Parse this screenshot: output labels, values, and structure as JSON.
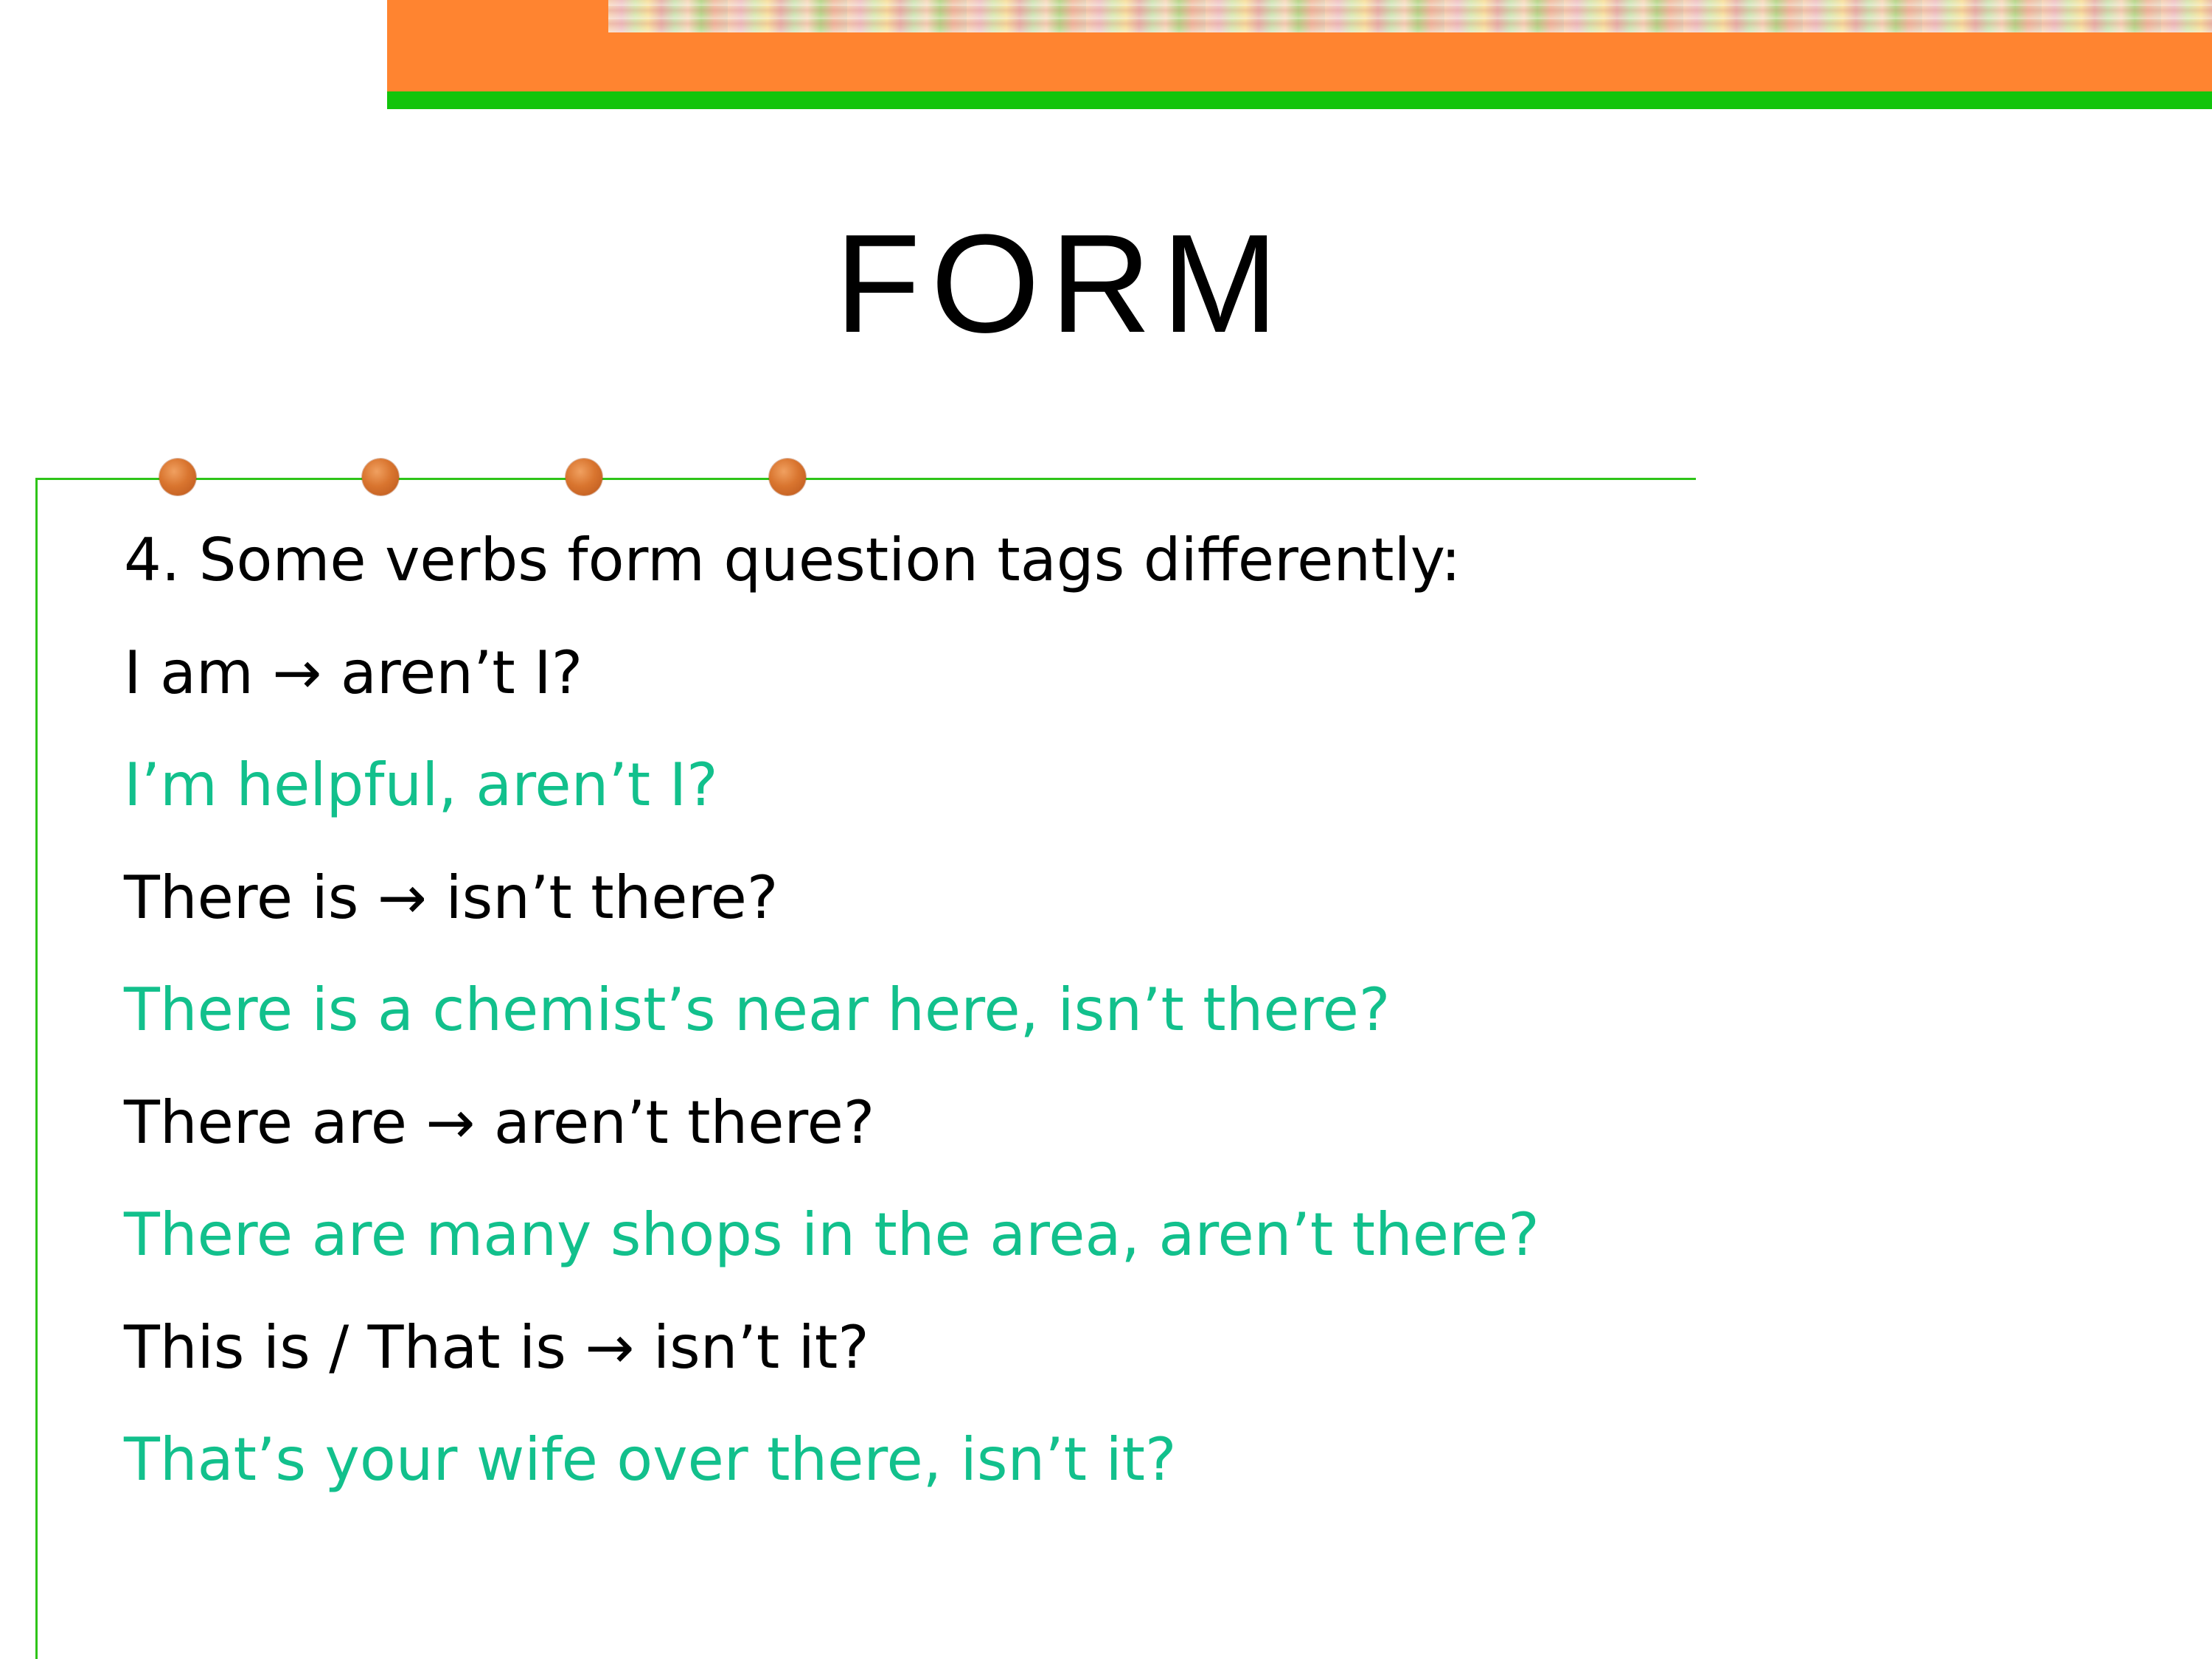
{
  "slide": {
    "title": "FORM",
    "lines": [
      {
        "text": "4. Some verbs form question tags differently:",
        "kind": "rule"
      },
      {
        "text": "I am → aren’t I?",
        "kind": "rule"
      },
      {
        "text": "I’m helpful, aren’t I?",
        "kind": "example"
      },
      {
        "text": "There is → isn’t there?",
        "kind": "rule"
      },
      {
        "text": "There is a chemist’s near here, isn’t there?",
        "kind": "example"
      },
      {
        "text": "There are → aren’t there?",
        "kind": "rule"
      },
      {
        "text": "There are many shops in the area, aren’t there?",
        "kind": "example"
      },
      {
        "text": "This is / That is → isn’t it?",
        "kind": "rule"
      },
      {
        "text": "That’s your wife over there, isn’t it?",
        "kind": "example"
      }
    ]
  },
  "colors": {
    "rule_text": "#000000",
    "example_text": "#12c08c",
    "banner_orange": "#ff8430",
    "banner_green": "#12c40b",
    "frame_line": "#2ec418",
    "bullet_dot": "#d9752f"
  }
}
